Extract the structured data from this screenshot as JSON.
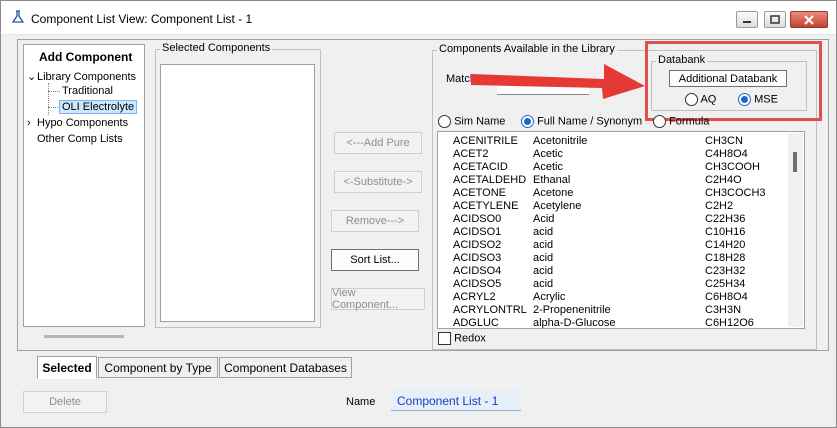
{
  "window": {
    "title": "Component List View: Component List - 1",
    "controls": [
      "minimize-icon",
      "maximize-icon",
      "close-icon"
    ]
  },
  "left_panel": {
    "heading": "Add Component",
    "tree": [
      {
        "label": "Library Components",
        "expanded": true
      },
      {
        "label": "Traditional"
      },
      {
        "label": "OLI Electrolyte",
        "selected": true
      },
      {
        "label": "Hypo Components",
        "expanded": false
      },
      {
        "label": "Other Comp Lists"
      }
    ]
  },
  "selected_components": {
    "legend": "Selected Components",
    "items": []
  },
  "actions": {
    "add_pure": "<---Add Pure",
    "substitute": "<-Substitute->",
    "remove": "Remove--->",
    "sort_list": "Sort List...",
    "view_component": "View Component..."
  },
  "library": {
    "legend": "Components Available in the Library",
    "match_label": "Match",
    "match_value": "",
    "databank": {
      "legend": "Databank",
      "button": "Additional Databank",
      "options": [
        "AQ",
        "MSE"
      ],
      "selected": "MSE"
    },
    "name_modes": [
      "Sim Name",
      "Full Name / Synonym",
      "Formula"
    ],
    "selected_mode": "Full Name / Synonym",
    "rows": [
      {
        "sim": "ACENITRILE",
        "full": "Acetonitrile",
        "formula": "CH3CN"
      },
      {
        "sim": "ACET2",
        "full": "Acetic",
        "formula": "C4H8O4"
      },
      {
        "sim": "ACETACID",
        "full": "Acetic",
        "formula": "CH3COOH"
      },
      {
        "sim": "ACETALDEHD",
        "full": "Ethanal",
        "formula": "C2H4O"
      },
      {
        "sim": "ACETONE",
        "full": "Acetone",
        "formula": "CH3COCH3"
      },
      {
        "sim": "ACETYLENE",
        "full": "Acetylene",
        "formula": "C2H2"
      },
      {
        "sim": "ACIDSO0",
        "full": "Acid",
        "formula": "C22H36"
      },
      {
        "sim": "ACIDSO1",
        "full": "acid",
        "formula": "C10H16"
      },
      {
        "sim": "ACIDSO2",
        "full": "acid",
        "formula": "C14H20"
      },
      {
        "sim": "ACIDSO3",
        "full": "acid",
        "formula": "C18H28"
      },
      {
        "sim": "ACIDSO4",
        "full": "acid",
        "formula": "C23H32"
      },
      {
        "sim": "ACIDSO5",
        "full": "acid",
        "formula": "C25H34"
      },
      {
        "sim": "ACRYL2",
        "full": "Acrylic",
        "formula": "C6H8O4"
      },
      {
        "sim": "ACRYLONTRL",
        "full": "2-Propenenitrile",
        "formula": "C3H3N"
      },
      {
        "sim": "ADGLUC",
        "full": "alpha-D-Glucose",
        "formula": "C6H12O6"
      }
    ],
    "redox_label": "Redox",
    "redox_checked": false
  },
  "tabs": [
    "Selected",
    "Component by Type",
    "Component Databases"
  ],
  "active_tab": "Selected",
  "footer": {
    "delete": "Delete",
    "name_label": "Name",
    "name_value": "Component List - 1"
  },
  "colors": {
    "highlight_box": "#e05050",
    "arrow": "#e53935",
    "selection": "#cce8ff",
    "name_text": "#1a3cc8"
  }
}
